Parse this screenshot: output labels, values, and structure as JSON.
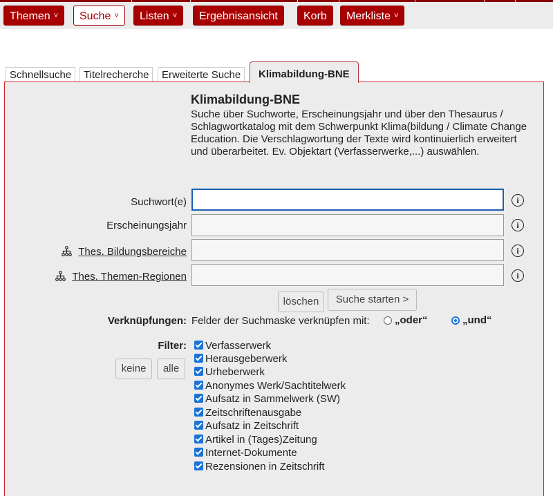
{
  "colors": {
    "brand": "#a80000",
    "panel_bg": "#ececec",
    "accent": "#1a73d8"
  },
  "nav": [
    {
      "label": "Themen",
      "caret": "˅"
    },
    {
      "label": "Suche",
      "caret": "˅",
      "active": true
    },
    {
      "label": "Listen",
      "caret": "˅"
    },
    {
      "label": "Ergebnisansicht"
    },
    {
      "label": "Korb"
    },
    {
      "label": "Merkliste",
      "caret": "˅"
    }
  ],
  "tabs": [
    {
      "label": "Schnellsuche"
    },
    {
      "label": "Titelrecherche"
    },
    {
      "label": "Erweiterte Suche"
    },
    {
      "label": "Klimabildung-BNE",
      "active": true
    }
  ],
  "form": {
    "heading": "Klimabildung-BNE",
    "description": "Suche über Suchworte, Erscheinungsjahr und über den Thesaurus / Schlagwortkatalog mit dem Schwerpunkt Klima(bildung / Climate Change Education. Die Verschlagwortung der Texte wird kontinuierlich erweitert und überarbeitet. Ev. Objektart (Verfasserwerke,...) auswählen.",
    "fields": [
      {
        "label": "Suchwort(e)",
        "value": "",
        "icon": "info-icon"
      },
      {
        "label": "Erscheinungsjahr",
        "value": "",
        "icon": "info-icon"
      },
      {
        "label": "Thes. Bildungsbereiche",
        "value": "",
        "icon": "info-icon",
        "tree_icon": "hierarchy-icon"
      },
      {
        "label": "Thes. Themen-Regionen",
        "value": "",
        "icon": "info-icon",
        "tree_icon": "hierarchy-icon"
      }
    ],
    "info_glyph": "i",
    "clear_label": "löschen",
    "search_label": "Suche starten >",
    "links": {
      "label": "Verknüpfungen:",
      "text": "Felder der Suchmaske verknüpfen mit:",
      "option_or": "„oder“",
      "option_and": "„und“",
      "selected": "und"
    },
    "filter": {
      "label": "Filter:",
      "none_label": "keine",
      "all_label": "alle",
      "items": [
        {
          "label": "Verfasserwerk",
          "checked": true
        },
        {
          "label": "Herausgeberwerk",
          "checked": true
        },
        {
          "label": "Urheberwerk",
          "checked": true
        },
        {
          "label": "Anonymes Werk/Sachtitelwerk",
          "checked": true
        },
        {
          "label": "Aufsatz in Sammelwerk (SW)",
          "checked": true
        },
        {
          "label": "Zeitschriftenausgabe",
          "checked": true
        },
        {
          "label": "Aufsatz in Zeitschrift",
          "checked": true
        },
        {
          "label": "Artikel in (Tages)Zeitung",
          "checked": true
        },
        {
          "label": "Internet-Dokumente",
          "checked": true
        },
        {
          "label": "Rezensionen in Zeitschrift",
          "checked": true
        }
      ]
    }
  }
}
